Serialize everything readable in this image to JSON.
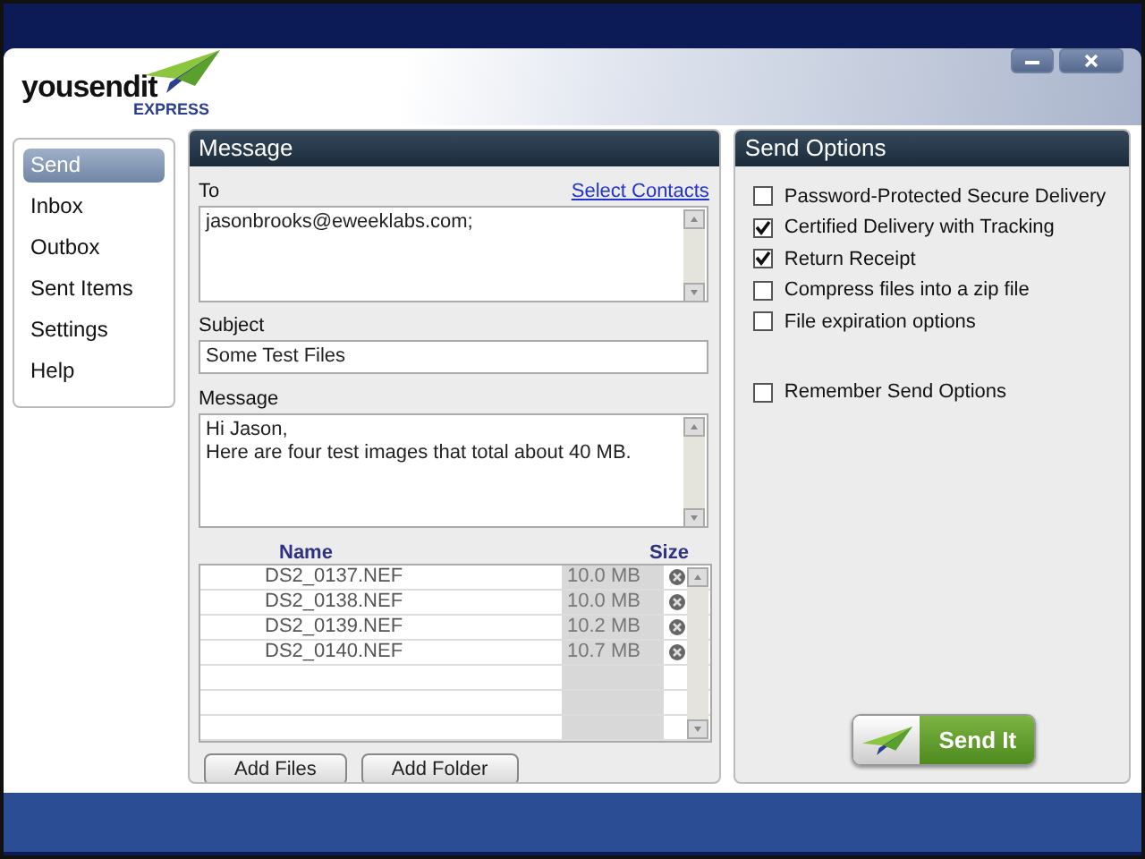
{
  "logo": {
    "name": "yousendit",
    "tagline": "EXPRESS"
  },
  "sidebar": {
    "items": [
      {
        "label": "Send",
        "selected": true
      },
      {
        "label": "Inbox",
        "selected": false
      },
      {
        "label": "Outbox",
        "selected": false
      },
      {
        "label": "Sent Items",
        "selected": false
      },
      {
        "label": "Settings",
        "selected": false
      },
      {
        "label": "Help",
        "selected": false
      }
    ]
  },
  "message_panel": {
    "title": "Message",
    "to": {
      "label": "To",
      "link": "Select Contacts",
      "value": "jasonbrooks@eweeklabs.com;"
    },
    "subject": {
      "label": "Subject",
      "value": "Some Test Files"
    },
    "message": {
      "label": "Message",
      "lines": [
        "Hi Jason,",
        "Here are four test images that total about 40 MB."
      ]
    },
    "files": {
      "columns": [
        "Name",
        "Size"
      ],
      "rows": [
        {
          "name": "DS2_0137.NEF",
          "size": "10.0 MB"
        },
        {
          "name": "DS2_0138.NEF",
          "size": "10.0 MB"
        },
        {
          "name": "DS2_0139.NEF",
          "size": "10.2 MB"
        },
        {
          "name": "DS2_0140.NEF",
          "size": "10.7 MB"
        }
      ]
    },
    "buttons": [
      "Add Files",
      "Add Folder"
    ]
  },
  "send_options": {
    "title": "Send Options",
    "options": [
      {
        "label": "Password-Protected Secure Delivery",
        "checked": false
      },
      {
        "label": "Certified Delivery with Tracking",
        "checked": true
      },
      {
        "label": "Return Receipt",
        "checked": true
      },
      {
        "label": "Compress files into a zip file",
        "checked": false
      },
      {
        "label": "File expiration options",
        "checked": false
      }
    ],
    "remember": {
      "label": "Remember Send Options",
      "checked": false
    },
    "send_button": "Send It"
  }
}
